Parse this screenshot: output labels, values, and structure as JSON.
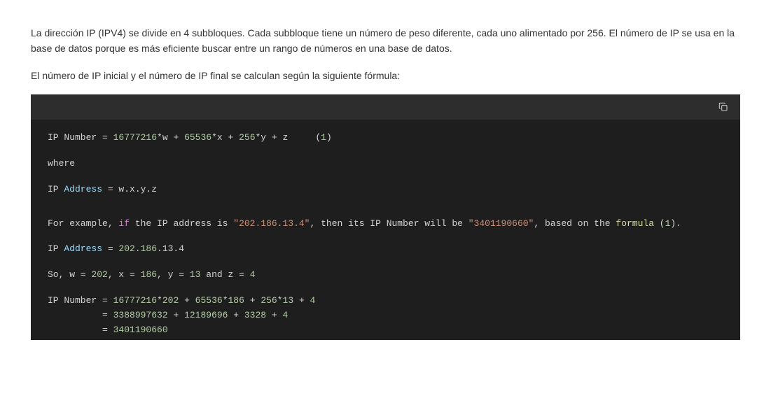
{
  "paragraphs": {
    "p1": "La dirección IP (IPV4) se divide en 4 subbloques. Cada subbloque tiene un número de peso diferente, cada uno alimentado por 256. El número de IP se usa en la base de datos porque es más eficiente buscar entre un rango de números en una base de datos.",
    "p2": "El número de IP inicial y el número de IP final se calculan según la siguiente fórmula:"
  },
  "code": {
    "l1_a": "IP Number = ",
    "l1_b": "16777216",
    "l1_c": "*w + ",
    "l1_d": "65536",
    "l1_e": "*x + ",
    "l1_f": "256",
    "l1_g": "*y + z     (",
    "l1_h": "1",
    "l1_i": ")",
    "l2": "where",
    "l3_a": "IP ",
    "l3_b": "Address",
    "l3_c": " = w.x.y.z",
    "l4_a": "For example, ",
    "l4_b": "if",
    "l4_c": " the IP address is ",
    "l4_d": "\"202.186.13.4\"",
    "l4_e": ", then its IP Number will be ",
    "l4_f": "\"3401190660\"",
    "l4_g": ", based on the ",
    "l4_h": "formula",
    "l4_i": " (",
    "l4_j": "1",
    "l4_k": ").",
    "l5_a": "IP ",
    "l5_b": "Address",
    "l5_c": " = ",
    "l5_d": "202.186",
    "l5_e": ".13.4",
    "l6_a": "So, w = ",
    "l6_b": "202",
    "l6_c": ", x = ",
    "l6_d": "186",
    "l6_e": ", y = ",
    "l6_f": "13",
    "l6_g": " and z = ",
    "l6_h": "4",
    "l7_a": "IP Number = ",
    "l7_b": "16777216",
    "l7_c": "*",
    "l7_d": "202",
    "l7_e": " + ",
    "l7_f": "65536",
    "l7_g": "*",
    "l7_h": "186",
    "l7_i": " + ",
    "l7_j": "256",
    "l7_k": "*",
    "l7_l": "13",
    "l7_m": " + ",
    "l7_n": "4",
    "l8_a": "          = ",
    "l8_b": "3388997632",
    "l8_c": " + ",
    "l8_d": "12189696",
    "l8_e": " + ",
    "l8_f": "3328",
    "l8_g": " + ",
    "l8_h": "4",
    "l9_a": "          = ",
    "l9_b": "3401190660"
  }
}
